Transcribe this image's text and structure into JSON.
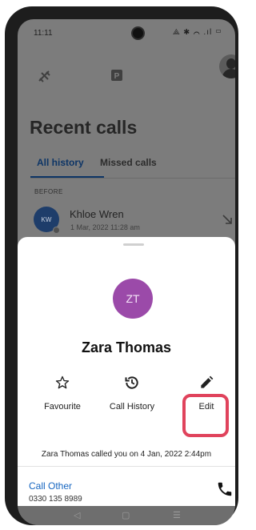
{
  "status_bar": {
    "time": "11:11",
    "icons_text": "⟁ ✱ ⌒ .ıl ▭"
  },
  "toolbar": {
    "icons": [
      "plane-icon",
      "moon-icon",
      "parking-icon"
    ],
    "profile_avatar": "profile-avatar",
    "online_color": "#43a047"
  },
  "page": {
    "title": "Recent calls",
    "tabs": [
      {
        "label": "All history",
        "active": true
      },
      {
        "label": "Missed calls",
        "active": false
      }
    ],
    "section_label": "BEFORE",
    "call_entry": {
      "initials": "KW",
      "name": "Khloe Wren",
      "datetime": "1 Mar, 2022 11:28 am",
      "direction_icon": "arrow-down-right-icon"
    }
  },
  "sheet": {
    "contact": {
      "initials": "ZT",
      "name": "Zara Thomas",
      "avatar_color": "#9b4aa9"
    },
    "actions": [
      {
        "label": "Favourite",
        "icon": "star-outline-icon"
      },
      {
        "label": "Call History",
        "icon": "history-icon"
      },
      {
        "label": "Edit",
        "icon": "pencil-icon"
      }
    ],
    "highlight_color": "#e0435c",
    "info": "Zara Thomas called you on 4 Jan, 2022 2:44pm",
    "call_other": {
      "label": "Call Other",
      "number": "0330 135 8989",
      "link_color": "#1565c0"
    }
  },
  "navbar": {
    "back": "◁",
    "home": "▢",
    "menu": "☰"
  }
}
